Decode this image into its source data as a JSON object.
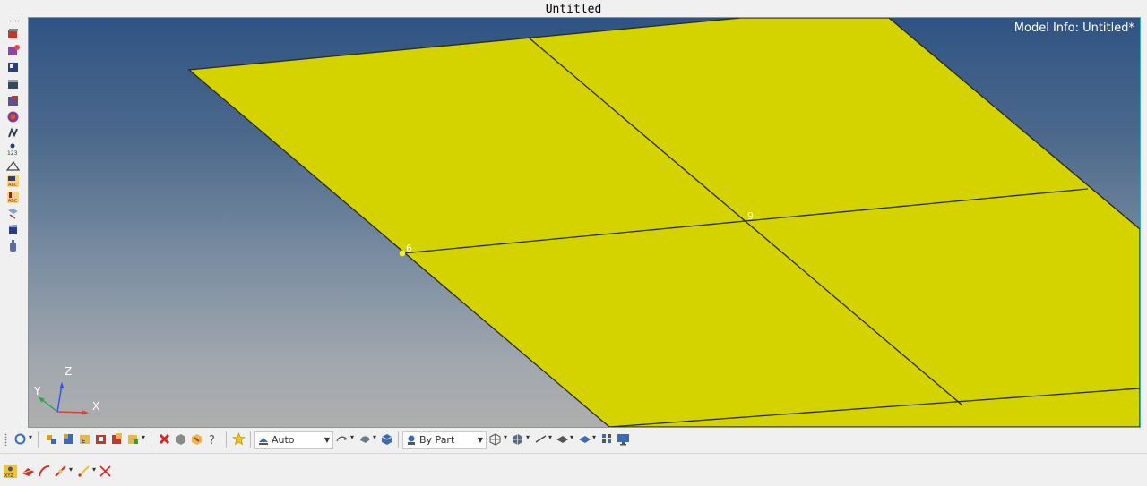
{
  "window": {
    "title": "Untitled"
  },
  "viewport": {
    "model_info": "Model Info: Untitled*",
    "node_labels": [
      "6",
      "9"
    ],
    "axes": {
      "x": "X",
      "y": "Y",
      "z": "Z"
    },
    "colors": {
      "surface": "#d4d300",
      "edges": "#2a2a2a",
      "bg_top": "#2f5383",
      "bg_bottom": "#aeaeae",
      "border": "#38b3c3"
    }
  },
  "left_toolbar": {
    "icons": [
      "geometry-panel-icon",
      "mesh-panel-icon",
      "element-panel-icon",
      "property-panel-icon",
      "material-panel-icon",
      "component-color-icon",
      "connector-icon",
      "numbering-icon",
      "label-icon",
      "abc-label-icon",
      "element-abc-label-icon",
      "dimension-icon",
      "page-icon",
      "bottle-icon"
    ]
  },
  "bottom_toolbar": {
    "display_mode": "Auto",
    "color_mode": "By Part"
  }
}
